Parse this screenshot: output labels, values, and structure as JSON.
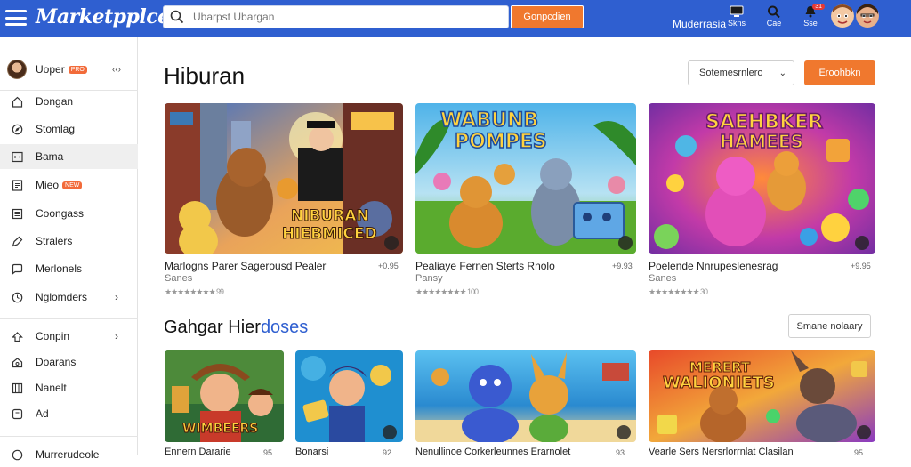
{
  "app": {
    "logo": "Marketpplce",
    "search_placeholder": "Ubarpst Ubargan",
    "search_button": "Gonpcdien",
    "top_link": "Muderrasia"
  },
  "top_icons": [
    {
      "icon": "monitor-icon",
      "label": "Skns"
    },
    {
      "icon": "search-icon",
      "label": "Cae"
    },
    {
      "icon": "notification-icon",
      "label": "Sse",
      "badge": "31"
    }
  ],
  "sidebar": {
    "user": {
      "name": "Uoper",
      "badge": "PRO",
      "more": "‹‹›"
    },
    "items": [
      {
        "label": "Dongan",
        "icon": "home-icon"
      },
      {
        "label": "Stomlag",
        "icon": "compass-icon"
      },
      {
        "label": "Bama",
        "icon": "gamepad-icon",
        "active": true
      },
      {
        "label": "Mieo",
        "icon": "film-icon",
        "badge": "NEW"
      },
      {
        "label": "Coongass",
        "icon": "list-icon"
      },
      {
        "label": "Stralers",
        "icon": "tag-icon"
      },
      {
        "label": "Merlonels",
        "icon": "chat-icon"
      },
      {
        "label": "Nglomders",
        "icon": "clock-icon",
        "chevron": "›"
      },
      {
        "label": "Conpin",
        "icon": "star-icon",
        "chevron": "›"
      },
      {
        "label": "Doarans",
        "icon": "gift-icon"
      },
      {
        "label": "Nanelt",
        "icon": "grid-icon"
      },
      {
        "label": "Ad",
        "icon": "ad-icon"
      },
      {
        "label": "Murrerudeole",
        "icon": "cart-icon"
      }
    ]
  },
  "main": {
    "title": "Hiburan",
    "sort_label": "Sotemesrnlero",
    "action_button": "Eroohbkn",
    "section2_title_a": "Gahgar Hier",
    "section2_title_b": "doses",
    "see_more": "Smane nolaary"
  },
  "featured": [
    {
      "title": "Marlogns Parer Sagerousd Pealer",
      "price": "+0.95",
      "sub": "Sanes",
      "rating": "★★★★★★★★ 99",
      "banner": "NIBURAN HIEBMICED"
    },
    {
      "title": "Pealiaye Fernen Sterts Rnolo",
      "price": "+9.93",
      "sub": "Pansy",
      "rating": "★★★★★★★★ 100",
      "banner": "WABUNB POMPES"
    },
    {
      "title": "Poelende Nnrupeslenesrag",
      "price": "+9.95",
      "sub": "Sanes",
      "rating": "★★★★★★★★ 30",
      "banner": "SAEHBKER HAMEES"
    }
  ],
  "section2": [
    {
      "title": "Ennern Dararie",
      "price": "95",
      "banner": "WIMBEERS"
    },
    {
      "title": "Bonarsi",
      "price": "92",
      "banner": ""
    },
    {
      "title": "Nenullinoe Corkerleunnes Erarnolet",
      "price": "93",
      "banner": ""
    },
    {
      "title": "Vearle Sers Nersrlorrnlat Clasilan",
      "price": "95",
      "banner": "MERERT WALIONIETS"
    }
  ],
  "colors": {
    "topbar": "#2f5fd0",
    "accent_orange": "#f0782e",
    "active_bg": "#efefef"
  }
}
